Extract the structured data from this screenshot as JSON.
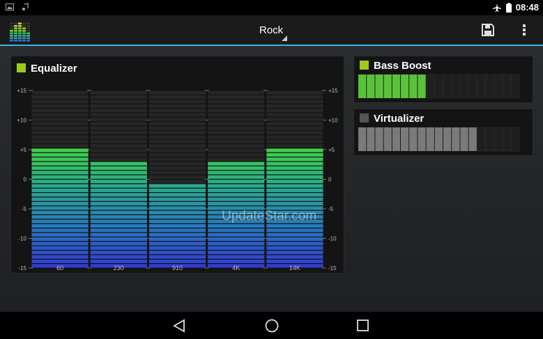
{
  "status_bar": {
    "time": "08:48",
    "left_icons": [
      "image-notification-icon",
      "music-notification-icon"
    ],
    "right_icons": [
      "airplane-mode-icon",
      "battery-icon"
    ]
  },
  "action_bar": {
    "app_icon": "equalizer-app-icon",
    "preset": "Rock",
    "save_icon": "save-icon",
    "menu_icon": "overflow-menu-icon"
  },
  "equalizer": {
    "title": "Equalizer",
    "enabled": true,
    "scale_labels": [
      "+15",
      "+10",
      "+5",
      "0",
      "-5",
      "-10",
      "-15"
    ],
    "bands": [
      {
        "label": "60",
        "gain": 5
      },
      {
        "label": "230",
        "gain": 3
      },
      {
        "label": "910",
        "gain": -1
      },
      {
        "label": "4K",
        "gain": 3
      },
      {
        "label": "14K",
        "gain": 5
      }
    ],
    "range": [
      -15,
      15
    ]
  },
  "bass_boost": {
    "title": "Bass Boost",
    "enabled": true,
    "level_segments": 8,
    "total_segments": 19,
    "active_color": "#59c23a"
  },
  "virtualizer": {
    "title": "Virtualizer",
    "enabled": false,
    "level_segments": 14,
    "total_segments": 19,
    "active_color": "#7a7a7a"
  },
  "watermark": "UpdateStar.com",
  "nav_bar": {
    "back_icon": "back-icon",
    "home_icon": "home-icon",
    "recents_icon": "recents-icon"
  },
  "colors": {
    "accent": "#33b5e5",
    "checkbox_on": "#9ccc1c",
    "checkbox_off": "#555555"
  }
}
